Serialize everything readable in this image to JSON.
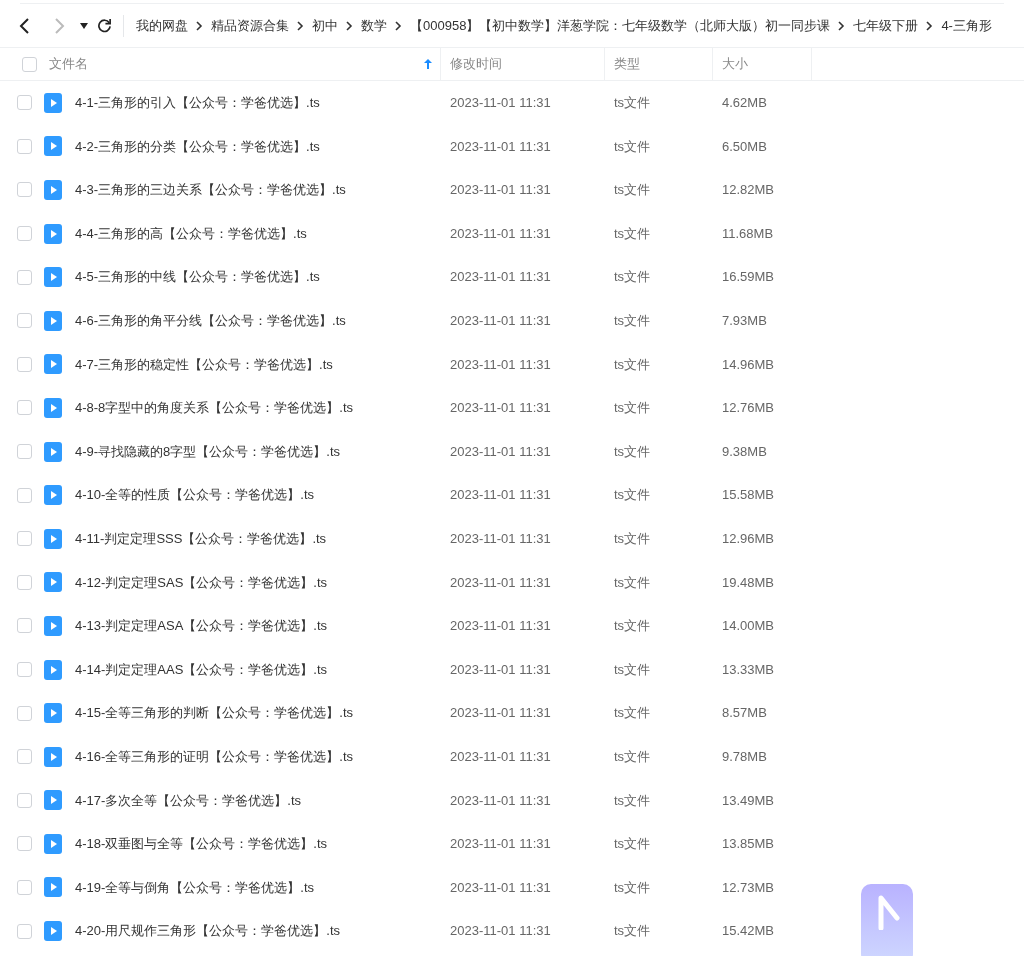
{
  "breadcrumb": [
    "我的网盘",
    "精品资源合集",
    "初中",
    "数学",
    "【000958】【初中数学】洋葱学院：七年级数学（北师大版）初一同步课",
    "七年级下册",
    "4-三角形"
  ],
  "columns": [
    {
      "label": "文件名",
      "sorted": true
    },
    {
      "label": "修改时间",
      "sorted": false
    },
    {
      "label": "类型",
      "sorted": false
    },
    {
      "label": "大小",
      "sorted": false
    }
  ],
  "select_all": {
    "checked": false
  },
  "rows": [
    {
      "name": "4-1-三角形的引入【公众号：学爸优选】.ts",
      "time": "2023-11-01 11:31",
      "type": "ts文件",
      "size": "4.62MB",
      "checked": false
    },
    {
      "name": "4-2-三角形的分类【公众号：学爸优选】.ts",
      "time": "2023-11-01 11:31",
      "type": "ts文件",
      "size": "6.50MB",
      "checked": false
    },
    {
      "name": "4-3-三角形的三边关系【公众号：学爸优选】.ts",
      "time": "2023-11-01 11:31",
      "type": "ts文件",
      "size": "12.82MB",
      "checked": false
    },
    {
      "name": "4-4-三角形的高【公众号：学爸优选】.ts",
      "time": "2023-11-01 11:31",
      "type": "ts文件",
      "size": "11.68MB",
      "checked": false
    },
    {
      "name": "4-5-三角形的中线【公众号：学爸优选】.ts",
      "time": "2023-11-01 11:31",
      "type": "ts文件",
      "size": "16.59MB",
      "checked": false
    },
    {
      "name": "4-6-三角形的角平分线【公众号：学爸优选】.ts",
      "time": "2023-11-01 11:31",
      "type": "ts文件",
      "size": "7.93MB",
      "checked": false
    },
    {
      "name": "4-7-三角形的稳定性【公众号：学爸优选】.ts",
      "time": "2023-11-01 11:31",
      "type": "ts文件",
      "size": "14.96MB",
      "checked": false
    },
    {
      "name": "4-8-8字型中的角度关系【公众号：学爸优选】.ts",
      "time": "2023-11-01 11:31",
      "type": "ts文件",
      "size": "12.76MB",
      "checked": false
    },
    {
      "name": "4-9-寻找隐藏的8字型【公众号：学爸优选】.ts",
      "time": "2023-11-01 11:31",
      "type": "ts文件",
      "size": "9.38MB",
      "checked": false
    },
    {
      "name": "4-10-全等的性质【公众号：学爸优选】.ts",
      "time": "2023-11-01 11:31",
      "type": "ts文件",
      "size": "15.58MB",
      "checked": false
    },
    {
      "name": "4-11-判定定理SSS【公众号：学爸优选】.ts",
      "time": "2023-11-01 11:31",
      "type": "ts文件",
      "size": "12.96MB",
      "checked": false
    },
    {
      "name": "4-12-判定定理SAS【公众号：学爸优选】.ts",
      "time": "2023-11-01 11:31",
      "type": "ts文件",
      "size": "19.48MB",
      "checked": false
    },
    {
      "name": "4-13-判定定理ASA【公众号：学爸优选】.ts",
      "time": "2023-11-01 11:31",
      "type": "ts文件",
      "size": "14.00MB",
      "checked": false
    },
    {
      "name": "4-14-判定定理AAS【公众号：学爸优选】.ts",
      "time": "2023-11-01 11:31",
      "type": "ts文件",
      "size": "13.33MB",
      "checked": false
    },
    {
      "name": "4-15-全等三角形的判断【公众号：学爸优选】.ts",
      "time": "2023-11-01 11:31",
      "type": "ts文件",
      "size": "8.57MB",
      "checked": false
    },
    {
      "name": "4-16-全等三角形的证明【公众号：学爸优选】.ts",
      "time": "2023-11-01 11:31",
      "type": "ts文件",
      "size": "9.78MB",
      "checked": false
    },
    {
      "name": "4-17-多次全等【公众号：学爸优选】.ts",
      "time": "2023-11-01 11:31",
      "type": "ts文件",
      "size": "13.49MB",
      "checked": false
    },
    {
      "name": "4-18-双垂图与全等【公众号：学爸优选】.ts",
      "time": "2023-11-01 11:31",
      "type": "ts文件",
      "size": "13.85MB",
      "checked": false
    },
    {
      "name": "4-19-全等与倒角【公众号：学爸优选】.ts",
      "time": "2023-11-01 11:31",
      "type": "ts文件",
      "size": "12.73MB",
      "checked": false
    },
    {
      "name": "4-20-用尺规作三角形【公众号：学爸优选】.ts",
      "time": "2023-11-01 11:31",
      "type": "ts文件",
      "size": "15.42MB",
      "checked": false
    }
  ]
}
